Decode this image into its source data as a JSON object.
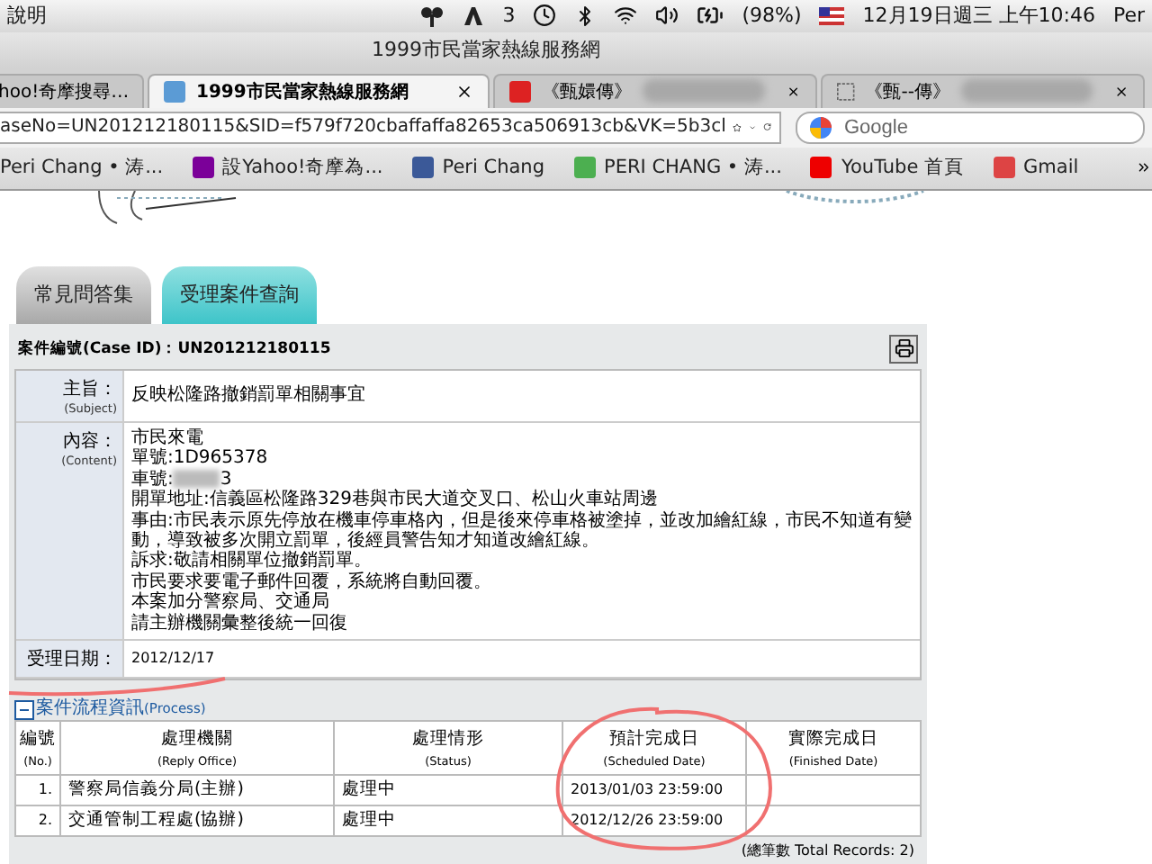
{
  "menubar": {
    "menu": "說明",
    "badge_count": "3",
    "battery": "(98%)",
    "clock": "12月19日週三 上午10:46",
    "user": "Per"
  },
  "window": {
    "title": "1999市民當家熱線服務網"
  },
  "browser_tabs": [
    {
      "title": "hoo!奇摩搜尋…",
      "selected": false,
      "blurred": false
    },
    {
      "title": "1999市民當家熱線服務網",
      "selected": true,
      "blurred": false
    },
    {
      "title": "《甄嬛傳》",
      "selected": false,
      "blurred": true
    },
    {
      "title": "《甄--傳》",
      "selected": false,
      "blurred": true
    }
  ],
  "address_bar": {
    "url": "aseNo=UN201212180115&SID=f579f720cbaffaffa82653ca506913cb&VK=5b3cl",
    "search_placeholder": "Google"
  },
  "bookmarks": [
    {
      "label": "Peri Chang • 涛...",
      "kind": "plain"
    },
    {
      "label": "設Yahoo!奇摩為...",
      "kind": "yahoo"
    },
    {
      "label": "Peri Chang",
      "kind": "facebook"
    },
    {
      "label": "PERI CHANG • 涛...",
      "kind": "green"
    },
    {
      "label": "YouTube 首頁",
      "kind": "youtube"
    },
    {
      "label": "Gmail",
      "kind": "gmail"
    }
  ],
  "page_tabs": [
    {
      "label": "常見問答集",
      "selected": false
    },
    {
      "label": "受理案件查詢",
      "selected": true
    }
  ],
  "case": {
    "header": "案件編號(Case ID)：UN201212180115",
    "fields": [
      {
        "label": "主旨：",
        "sublabel": "(Subject)",
        "lines": [
          "反映松隆路撤銷罰單相關事宜"
        ]
      },
      {
        "label": "內容：",
        "sublabel": "(Content)",
        "lines": [
          "市民來電",
          "單號:1D965378",
          "車號:",
          "開單地址:信義區松隆路329巷與市民大道交叉口、松山火車站周邊",
          "事由:市民表示原先停放在機車停車格內，但是後來停車格被塗掉，並改加繪紅線，市民不知道有變動，導致被多次開立罰單，後經員警告知才知道改繪紅線。",
          "訴求:敬請相關單位撤銷罰單。",
          "市民要求要電子郵件回覆，系統將自動回覆。",
          "本案加分警察局、交通局",
          "請主辦機關彙整後統一回復"
        ]
      }
    ],
    "redacted_suffix": "3",
    "date_label": "受理日期：",
    "date_value": "2012/12/17"
  },
  "process": {
    "title": "案件流程資訊",
    "title_en": "(Process)",
    "columns": [
      {
        "zh": "編號",
        "en": "(No.)"
      },
      {
        "zh": "處理機關",
        "en": "(Reply Office)"
      },
      {
        "zh": "處理情形",
        "en": "(Status)"
      },
      {
        "zh": "預計完成日",
        "en": "(Scheduled Date)"
      },
      {
        "zh": "實際完成日",
        "en": "(Finished Date)"
      }
    ],
    "rows": [
      [
        "1.",
        "警察局信義分局(主辦)",
        "處理中",
        "2013/01/03 23:59:00",
        ""
      ],
      [
        "2.",
        "交通管制工程處(協辦)",
        "處理中",
        "2012/12/26 23:59:00",
        ""
      ]
    ],
    "total": "(總筆數 Total Records: 2)"
  }
}
